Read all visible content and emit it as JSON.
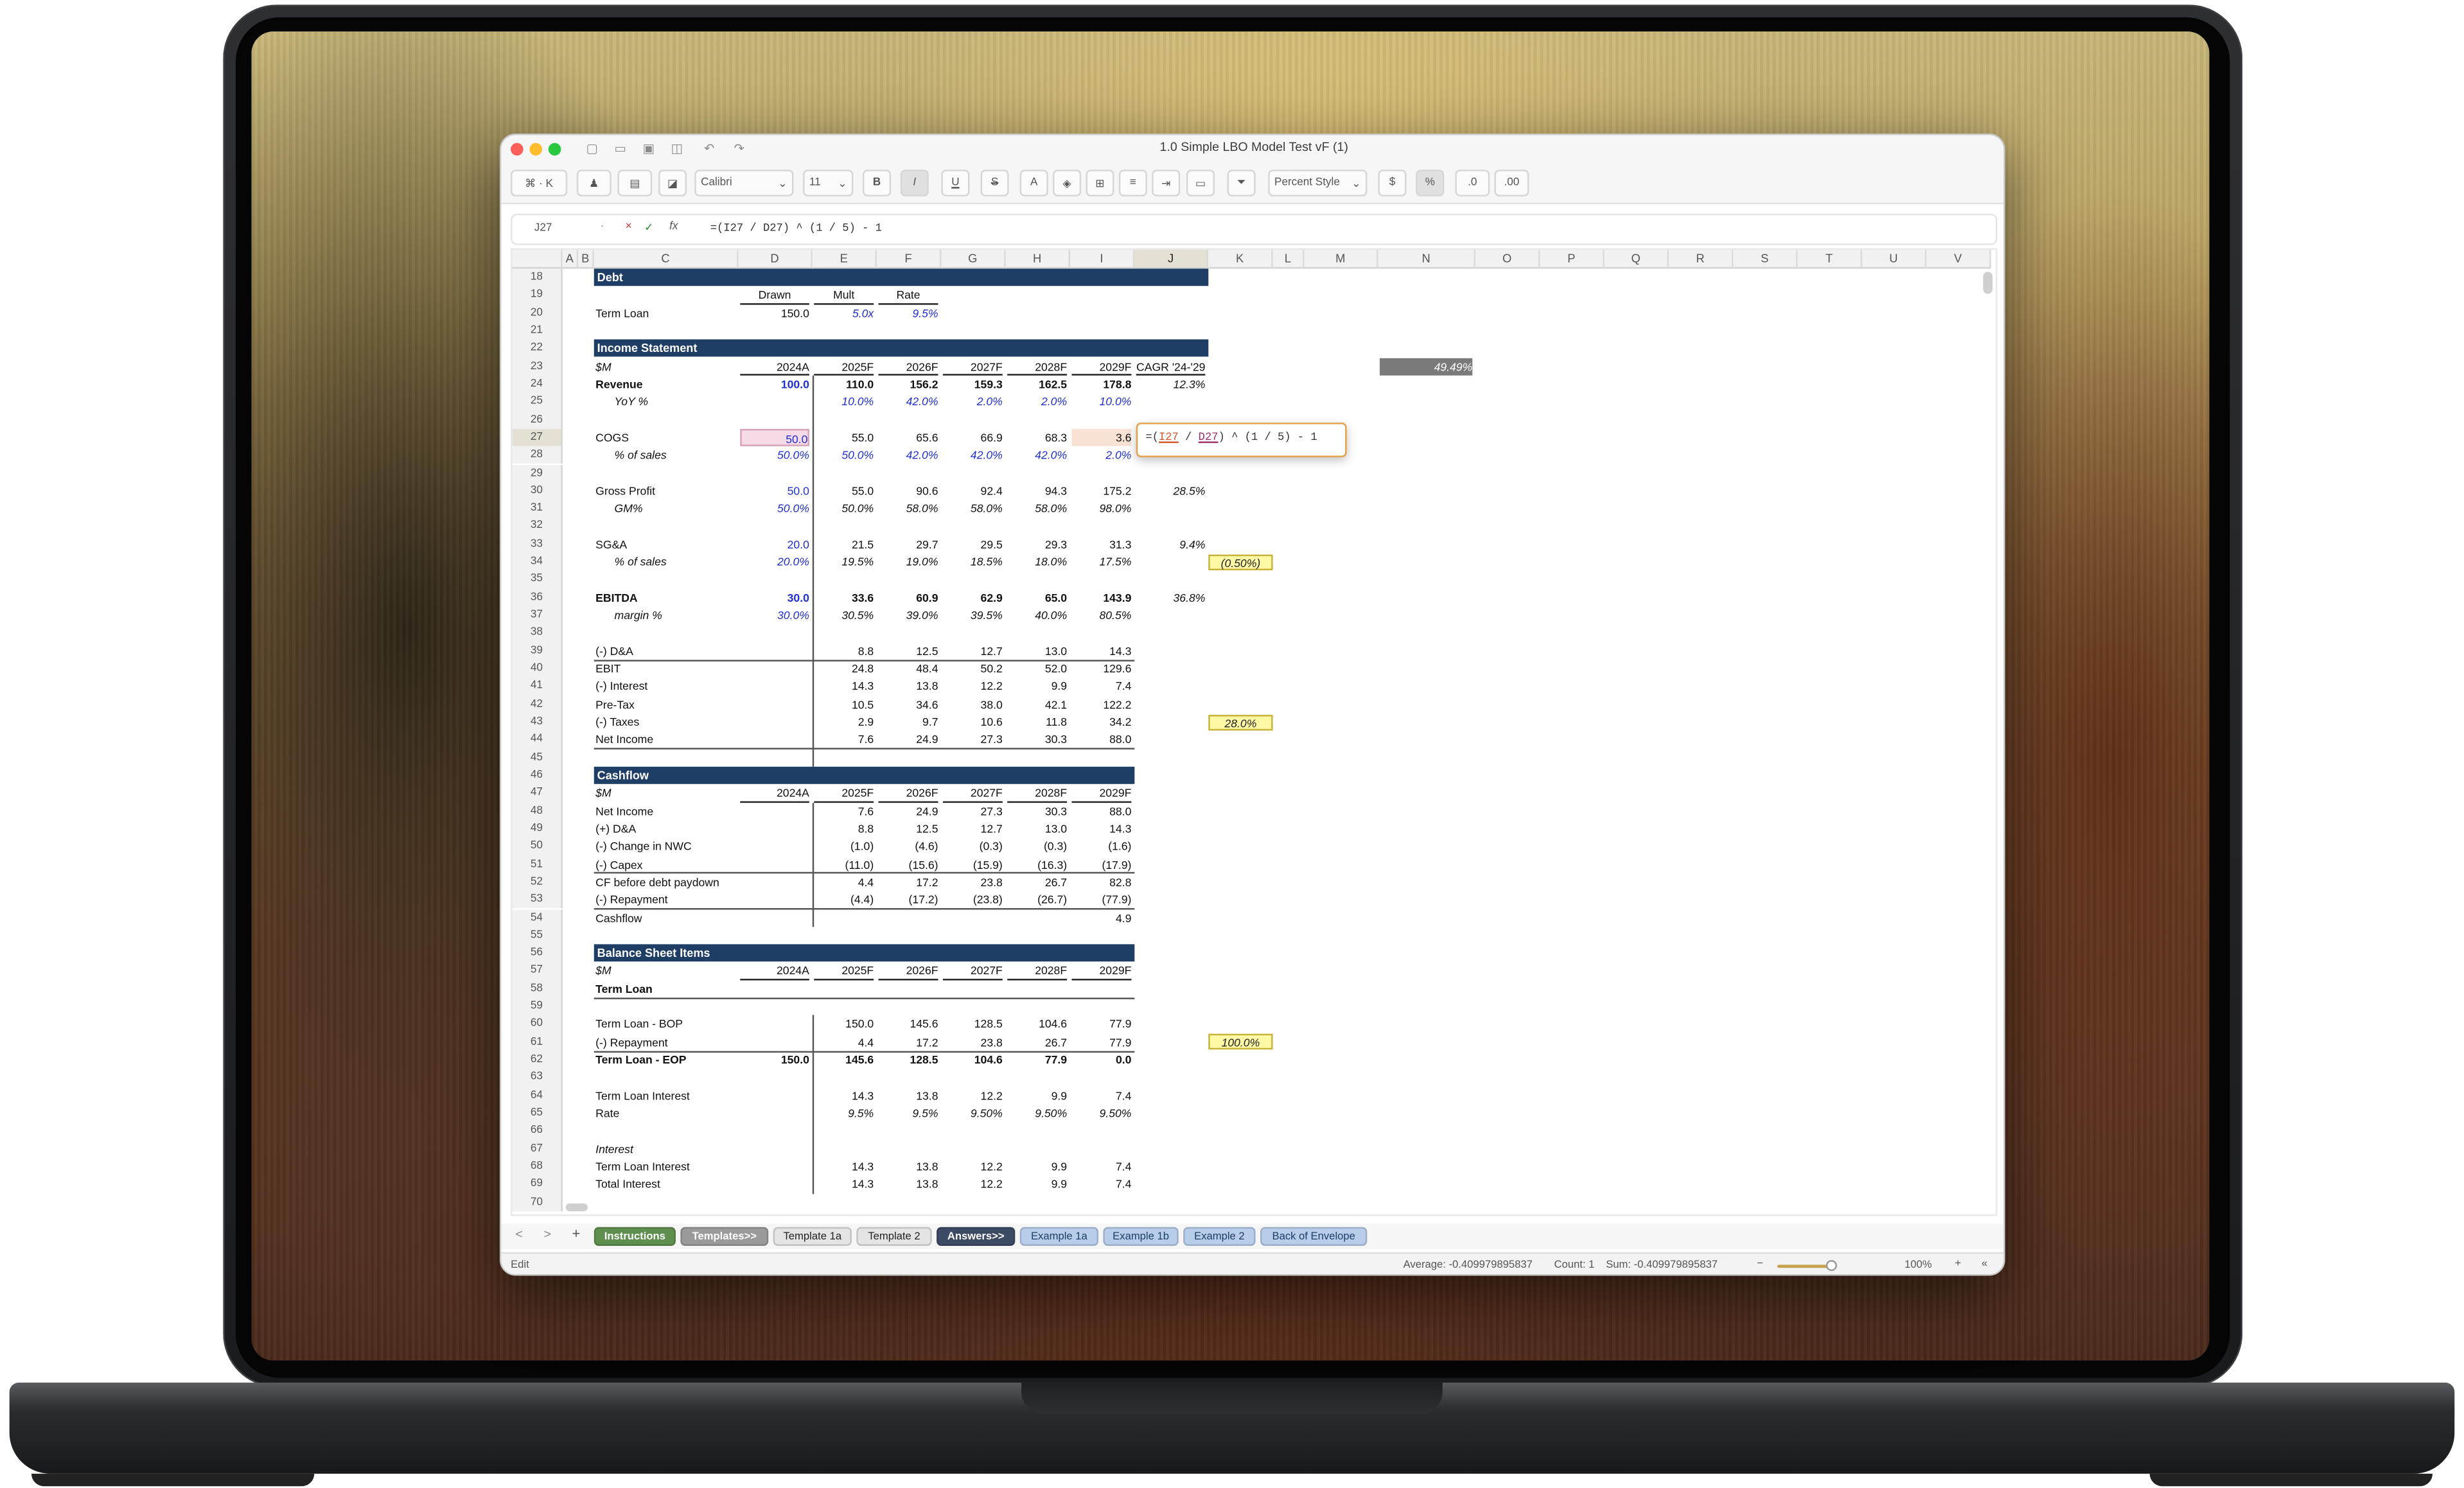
{
  "window": {
    "title": "1.0 Simple LBO Model Test vF (1)"
  },
  "toolbar": {
    "command_shortcut": "⌘ · K",
    "font_name": "Calibri",
    "font_size": "11",
    "bold": "B",
    "italic": "I",
    "underline": "U",
    "strike": "S",
    "number_style": "Percent Style",
    "currency": "$",
    "percent": "%",
    "dec_more": ".0",
    "dec_less": ".00"
  },
  "formula_bar": {
    "cell_ref": "J27",
    "fx": "fx",
    "formula": "=(I27 / D27) ^ (1 / 5) - 1",
    "editor_formula": "=(I27 / D27) ^ (1 / 5) - 1",
    "editor_ref1": "I27",
    "editor_ref2": "D27"
  },
  "columns": [
    "A",
    "B",
    "C",
    "D",
    "E",
    "F",
    "G",
    "H",
    "I",
    "J",
    "K",
    "L",
    "M",
    "N",
    "O",
    "P",
    "Q",
    "R",
    "S",
    "T",
    "U",
    "V"
  ],
  "rows": [
    "18",
    "19",
    "20",
    "21",
    "22",
    "23",
    "24",
    "25",
    "26",
    "27",
    "28",
    "29",
    "30",
    "31",
    "32",
    "33",
    "34",
    "35",
    "36",
    "37",
    "38",
    "39",
    "40",
    "41",
    "42",
    "43",
    "44",
    "45",
    "46",
    "47",
    "48",
    "49",
    "50",
    "51",
    "52",
    "53",
    "54",
    "55",
    "56",
    "57",
    "58",
    "59",
    "60",
    "61",
    "62",
    "63",
    "64",
    "65",
    "66",
    "67",
    "68",
    "69",
    "70"
  ],
  "sheet": {
    "debt_title": "Debt",
    "debt_headers": [
      "Drawn",
      "Mult",
      "Rate"
    ],
    "term_loan": {
      "label": "Term Loan",
      "drawn": "150.0",
      "mult": "5.0x",
      "rate": "9.5%"
    },
    "is_title": "Income Statement",
    "units": "$M",
    "years": [
      "2024A",
      "2025F",
      "2026F",
      "2027F",
      "2028F",
      "2029F"
    ],
    "cagr_header": "CAGR '24-'29",
    "side_value": "49.49%",
    "is_rows": [
      {
        "label": "Revenue",
        "vals": [
          "100.0",
          "110.0",
          "156.2",
          "159.3",
          "162.5",
          "178.8"
        ],
        "cagr": "12.3%"
      },
      {
        "label": "YoY %",
        "vals": [
          "",
          "10.0%",
          "42.0%",
          "2.0%",
          "2.0%",
          "10.0%"
        ],
        "cagr": ""
      },
      {
        "label": "COGS",
        "vals": [
          "50.0",
          "55.0",
          "65.6",
          "66.9",
          "68.3",
          "3.6"
        ],
        "cagr": ""
      },
      {
        "label": "% of sales",
        "vals": [
          "50.0%",
          "50.0%",
          "42.0%",
          "42.0%",
          "42.0%",
          "2.0%"
        ],
        "cagr": ""
      },
      {
        "label": "Gross Profit",
        "vals": [
          "50.0",
          "55.0",
          "90.6",
          "92.4",
          "94.3",
          "175.2"
        ],
        "cagr": "28.5%"
      },
      {
        "label": "GM%",
        "vals": [
          "50.0%",
          "50.0%",
          "58.0%",
          "58.0%",
          "58.0%",
          "98.0%"
        ],
        "cagr": ""
      },
      {
        "label": "SG&A",
        "vals": [
          "20.0",
          "21.5",
          "29.7",
          "29.5",
          "29.3",
          "31.3"
        ],
        "cagr": "9.4%"
      },
      {
        "label": "% of sales",
        "vals": [
          "20.0%",
          "19.5%",
          "19.0%",
          "18.5%",
          "18.0%",
          "17.5%"
        ],
        "cagr": ""
      },
      {
        "label": "EBITDA",
        "vals": [
          "30.0",
          "33.6",
          "60.9",
          "62.9",
          "65.0",
          "143.9"
        ],
        "cagr": "36.8%"
      },
      {
        "label": "margin %",
        "vals": [
          "30.0%",
          "30.5%",
          "39.0%",
          "39.5%",
          "40.0%",
          "80.5%"
        ],
        "cagr": ""
      },
      {
        "label": "(-) D&A",
        "vals": [
          "",
          "8.8",
          "12.5",
          "12.7",
          "13.0",
          "14.3"
        ],
        "cagr": ""
      },
      {
        "label": "EBIT",
        "vals": [
          "",
          "24.8",
          "48.4",
          "50.2",
          "52.0",
          "129.6"
        ],
        "cagr": ""
      },
      {
        "label": "(-) Interest",
        "vals": [
          "",
          "14.3",
          "13.8",
          "12.2",
          "9.9",
          "7.4"
        ],
        "cagr": ""
      },
      {
        "label": "Pre-Tax",
        "vals": [
          "",
          "10.5",
          "34.6",
          "38.0",
          "42.1",
          "122.2"
        ],
        "cagr": ""
      },
      {
        "label": "(-) Taxes",
        "vals": [
          "",
          "2.9",
          "9.7",
          "10.6",
          "11.8",
          "34.2"
        ],
        "cagr": ""
      },
      {
        "label": "Net Income",
        "vals": [
          "",
          "7.6",
          "24.9",
          "27.3",
          "30.3",
          "88.0"
        ],
        "cagr": ""
      }
    ],
    "assumption_1": "(0.50%)",
    "assumption_2": "28.0%",
    "assumption_3": "100.0%",
    "cf_title": "Cashflow",
    "cf_rows": [
      {
        "label": "Net Income",
        "vals": [
          "",
          "7.6",
          "24.9",
          "27.3",
          "30.3",
          "88.0"
        ]
      },
      {
        "label": "(+) D&A",
        "vals": [
          "",
          "8.8",
          "12.5",
          "12.7",
          "13.0",
          "14.3"
        ]
      },
      {
        "label": "(-) Change in NWC",
        "vals": [
          "",
          "(1.0)",
          "(4.6)",
          "(0.3)",
          "(0.3)",
          "(1.6)"
        ]
      },
      {
        "label": "(-) Capex",
        "vals": [
          "",
          "(11.0)",
          "(15.6)",
          "(15.9)",
          "(16.3)",
          "(17.9)"
        ]
      },
      {
        "label": "CF before debt paydown",
        "vals": [
          "",
          "4.4",
          "17.2",
          "23.8",
          "26.7",
          "82.8"
        ]
      },
      {
        "label": "(-) Repayment",
        "vals": [
          "",
          "(4.4)",
          "(17.2)",
          "(23.8)",
          "(26.7)",
          "(77.9)"
        ]
      },
      {
        "label": "Cashflow",
        "vals": [
          "",
          "",
          "",
          "",
          "",
          "4.9"
        ]
      }
    ],
    "bs_title": "Balance Sheet Items",
    "bs_sub": "Term Loan",
    "bs_rows": [
      {
        "label": "Term Loan - BOP",
        "vals": [
          "",
          "150.0",
          "145.6",
          "128.5",
          "104.6",
          "77.9"
        ]
      },
      {
        "label": "(-) Repayment",
        "vals": [
          "",
          "4.4",
          "17.2",
          "23.8",
          "26.7",
          "77.9"
        ]
      },
      {
        "label": "Term Loan - EOP",
        "vals": [
          "150.0",
          "145.6",
          "128.5",
          "104.6",
          "77.9",
          "0.0"
        ]
      },
      {
        "label": "Term Loan Interest",
        "vals": [
          "",
          "14.3",
          "13.8",
          "12.2",
          "9.9",
          "7.4"
        ]
      },
      {
        "label": "Rate",
        "vals": [
          "",
          "9.5%",
          "9.5%",
          "9.50%",
          "9.50%",
          "9.50%"
        ]
      },
      {
        "label": "Interest",
        "vals": [
          "",
          "",
          "",
          "",
          "",
          ""
        ]
      },
      {
        "label": "Term Loan Interest",
        "vals": [
          "",
          "14.3",
          "13.8",
          "12.2",
          "9.9",
          "7.4"
        ]
      },
      {
        "label": "Total Interest",
        "vals": [
          "",
          "14.3",
          "13.8",
          "12.2",
          "9.9",
          "7.4"
        ]
      }
    ]
  },
  "tabs": [
    {
      "label": "Instructions",
      "color": "#5f8f4e",
      "fg": "#ffffff"
    },
    {
      "label": "Templates>>",
      "color": "#9a9a9a",
      "fg": "#ffffff"
    },
    {
      "label": "Template 1a",
      "color": "#e4e4e4",
      "fg": "#222222"
    },
    {
      "label": "Template 2",
      "color": "#e4e4e4",
      "fg": "#222222"
    },
    {
      "label": "Answers>>",
      "color": "#3d4a63",
      "fg": "#ffffff"
    },
    {
      "label": "Example 1a",
      "color": "#b8cdea",
      "fg": "#1f3e66"
    },
    {
      "label": "Example 1b",
      "color": "#b8cdea",
      "fg": "#1f3e66"
    },
    {
      "label": "Example 2",
      "color": "#b8cdea",
      "fg": "#1f3e66"
    },
    {
      "label": "Back of Envelope",
      "color": "#b8cdea",
      "fg": "#1f3e66"
    }
  ],
  "status": {
    "mode": "Edit",
    "average": "Average: -0.409979895837",
    "count": "Count: 1",
    "sum": "Sum: -0.409979895837",
    "zoom": "100%",
    "minus": "−",
    "plus": "+",
    "collapse": "«"
  },
  "nav": {
    "prev": "<",
    "next": ">",
    "add": "+"
  }
}
